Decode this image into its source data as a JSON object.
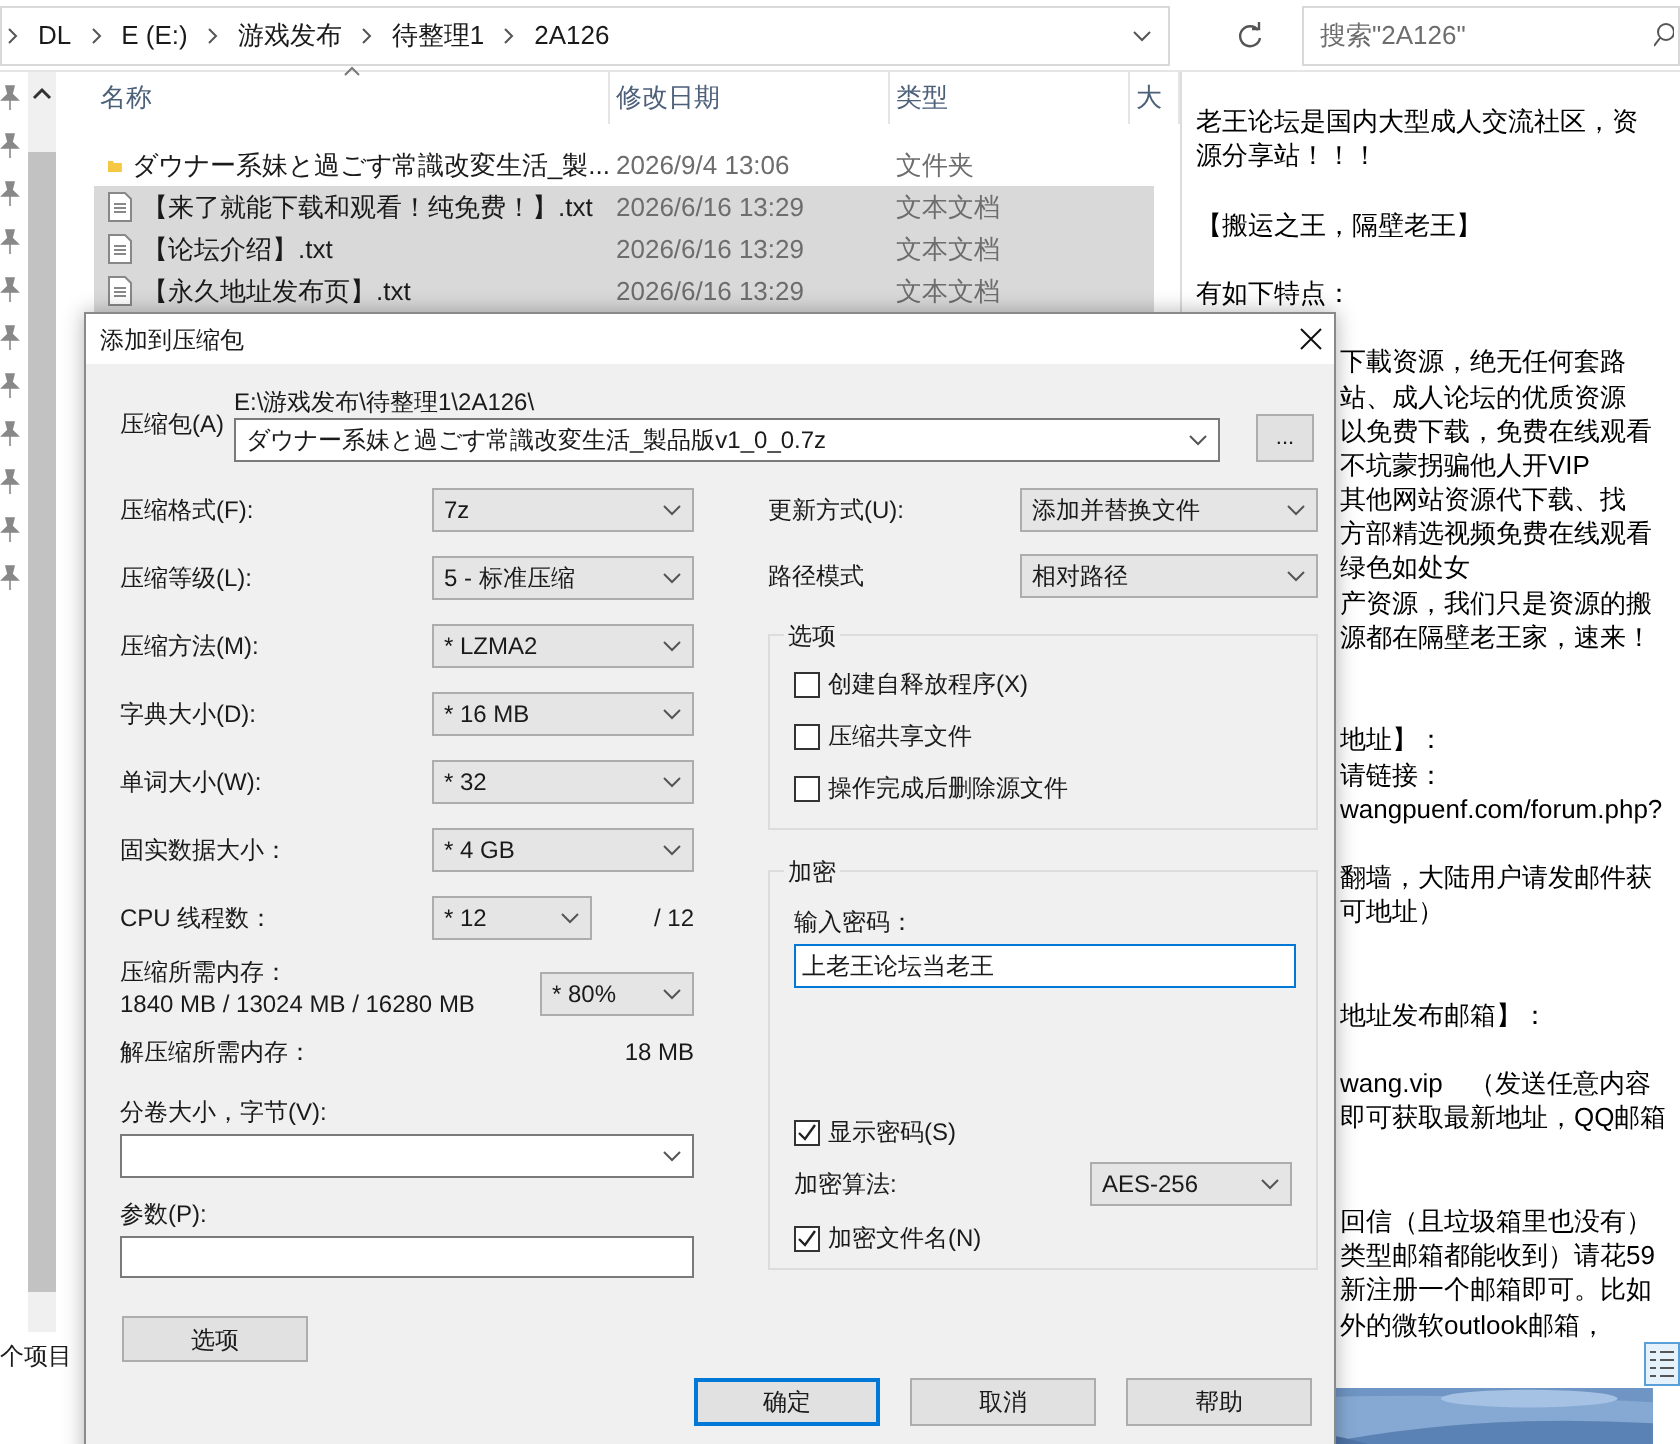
{
  "explorer": {
    "breadcrumb": [
      "DL",
      "E (E:)",
      "游戏发布",
      "待整理1",
      "2A126"
    ],
    "search": {
      "placeholder": "搜索\"2A126\""
    },
    "columns": [
      {
        "label": "名称",
        "sorted": true
      },
      {
        "label": "修改日期",
        "sorted": false
      },
      {
        "label": "类型",
        "sorted": false
      },
      {
        "label": "大",
        "sorted": false
      }
    ],
    "files": [
      {
        "kind": "folder",
        "name": "ダウナー系妹と過ごす常識改変生活_製...",
        "date": "2026/9/4 13:06",
        "type": "文件夹",
        "selected": false
      },
      {
        "kind": "text",
        "name": "【来了就能下载和观看！纯免费！】.txt",
        "date": "2026/6/16 13:29",
        "type": "文本文档",
        "selected": true
      },
      {
        "kind": "text",
        "name": "【论坛介绍】.txt",
        "date": "2026/6/16 13:29",
        "type": "文本文档",
        "selected": true
      },
      {
        "kind": "text",
        "name": "【永久地址发布页】.txt",
        "date": "2026/6/16 13:29",
        "type": "文本文档",
        "selected": true
      }
    ],
    "status": "个项目"
  },
  "notepad": {
    "lines": [
      {
        "kind": "full",
        "text": "老王论坛是国内大型成人交流社区，资"
      },
      {
        "kind": "full",
        "text": "源分享站！！！"
      },
      {
        "kind": "blank"
      },
      {
        "kind": "full",
        "text": "【搬运之王，隔壁老王】"
      },
      {
        "kind": "blank"
      },
      {
        "kind": "full",
        "text": "有如下特点："
      },
      {
        "kind": "blank"
      },
      {
        "kind": "partial",
        "text": "下載资源，绝无任何套路"
      },
      {
        "kind": "partial",
        "text": "站、成人论坛的优质资源"
      },
      {
        "kind": "partial",
        "text": "以免费下载，免费在线观看"
      },
      {
        "kind": "partial",
        "text": "不坑蒙拐骗他人开VIP"
      },
      {
        "kind": "partial",
        "text": "其他网站资源代下载、找"
      },
      {
        "kind": "partial",
        "text": "方部精选视频免费在线观看"
      },
      {
        "kind": "partial",
        "text": "绿色如处女"
      },
      {
        "kind": "partial",
        "text": "产资源，我们只是资源的搬"
      },
      {
        "kind": "partial",
        "text": "源都在隔壁老王家，速来！"
      },
      {
        "kind": "blank"
      },
      {
        "kind": "blank"
      },
      {
        "kind": "partial",
        "text": "地址】："
      },
      {
        "kind": "partial",
        "text": "请链接："
      },
      {
        "kind": "partial",
        "text": "wangpuenf.com/forum.php?"
      },
      {
        "kind": "blank"
      },
      {
        "kind": "partial",
        "text": "翻墙，大陆用户请发邮件获"
      },
      {
        "kind": "partial",
        "text": "可地址）"
      },
      {
        "kind": "blank"
      },
      {
        "kind": "blank"
      },
      {
        "kind": "partial",
        "text": "地址发布邮箱】："
      },
      {
        "kind": "blank"
      },
      {
        "kind": "partial",
        "text": "wang.vip　（发送任意内容"
      },
      {
        "kind": "partial",
        "text": "即可获取最新地址，QQ邮箱"
      },
      {
        "kind": "blank"
      },
      {
        "kind": "blank"
      },
      {
        "kind": "partial",
        "text": "回信（且垃圾箱里也没有）"
      },
      {
        "kind": "partial",
        "text": "类型邮箱都能收到）请花59"
      },
      {
        "kind": "partial",
        "text": "新注册一个邮箱即可。比如"
      },
      {
        "kind": "partial",
        "text": "外的微软outlook邮箱，"
      }
    ]
  },
  "dialog": {
    "title": "添加到压缩包",
    "archive": {
      "label": "压缩包(A)",
      "folder": "E:\\游戏发布\\待整理1\\2A126\\",
      "value": "ダウナー系妹と過ごす常識改変生活_製品版v1_0_0.7z",
      "browse": "..."
    },
    "settings": [
      {
        "label": "压缩格式(F):",
        "value": "7z"
      },
      {
        "label": "压缩等级(L):",
        "value": "5 - 标准压缩"
      },
      {
        "label": "压缩方法(M):",
        "value": "* LZMA2"
      },
      {
        "label": "字典大小(D):",
        "value": "* 16 MB"
      },
      {
        "label": "单词大小(W):",
        "value": "* 32"
      },
      {
        "label": "固实数据大小：",
        "value": "* 4 GB"
      }
    ],
    "threads": {
      "label": "CPU 线程数：",
      "value": "* 12",
      "max": "/ 12"
    },
    "memory": {
      "label": "压缩所需内存：",
      "detail": "1840 MB / 13024 MB / 16280 MB",
      "value": "* 80%"
    },
    "decompress_memory": {
      "label": "解压缩所需内存：",
      "value": "18 MB"
    },
    "volume": {
      "label": "分卷大小，字节(V):"
    },
    "parameters": {
      "label": "参数(P):"
    },
    "options_button": "选项",
    "update_mode": {
      "label": "更新方式(U):",
      "value": "添加并替换文件"
    },
    "path_mode": {
      "label": "路径模式",
      "value": "相对路径"
    },
    "options": {
      "title": "选项",
      "items": [
        {
          "label": "创建自释放程序(X)",
          "checked": false
        },
        {
          "label": "压缩共享文件",
          "checked": false
        },
        {
          "label": "操作完成后删除源文件",
          "checked": false
        }
      ]
    },
    "encryption": {
      "title": "加密",
      "password_label": "输入密码：",
      "password": "上老王论坛当老王",
      "focused": true,
      "show_password": {
        "label": "显示密码(S)",
        "checked": true
      },
      "method": {
        "label": "加密算法:",
        "value": "AES-256"
      },
      "encrypt_names": {
        "label": "加密文件名(N)",
        "checked": true
      }
    },
    "buttons": [
      {
        "label": "确定",
        "default": true
      },
      {
        "label": "取消",
        "default": false
      },
      {
        "label": "帮助",
        "default": false
      }
    ]
  }
}
